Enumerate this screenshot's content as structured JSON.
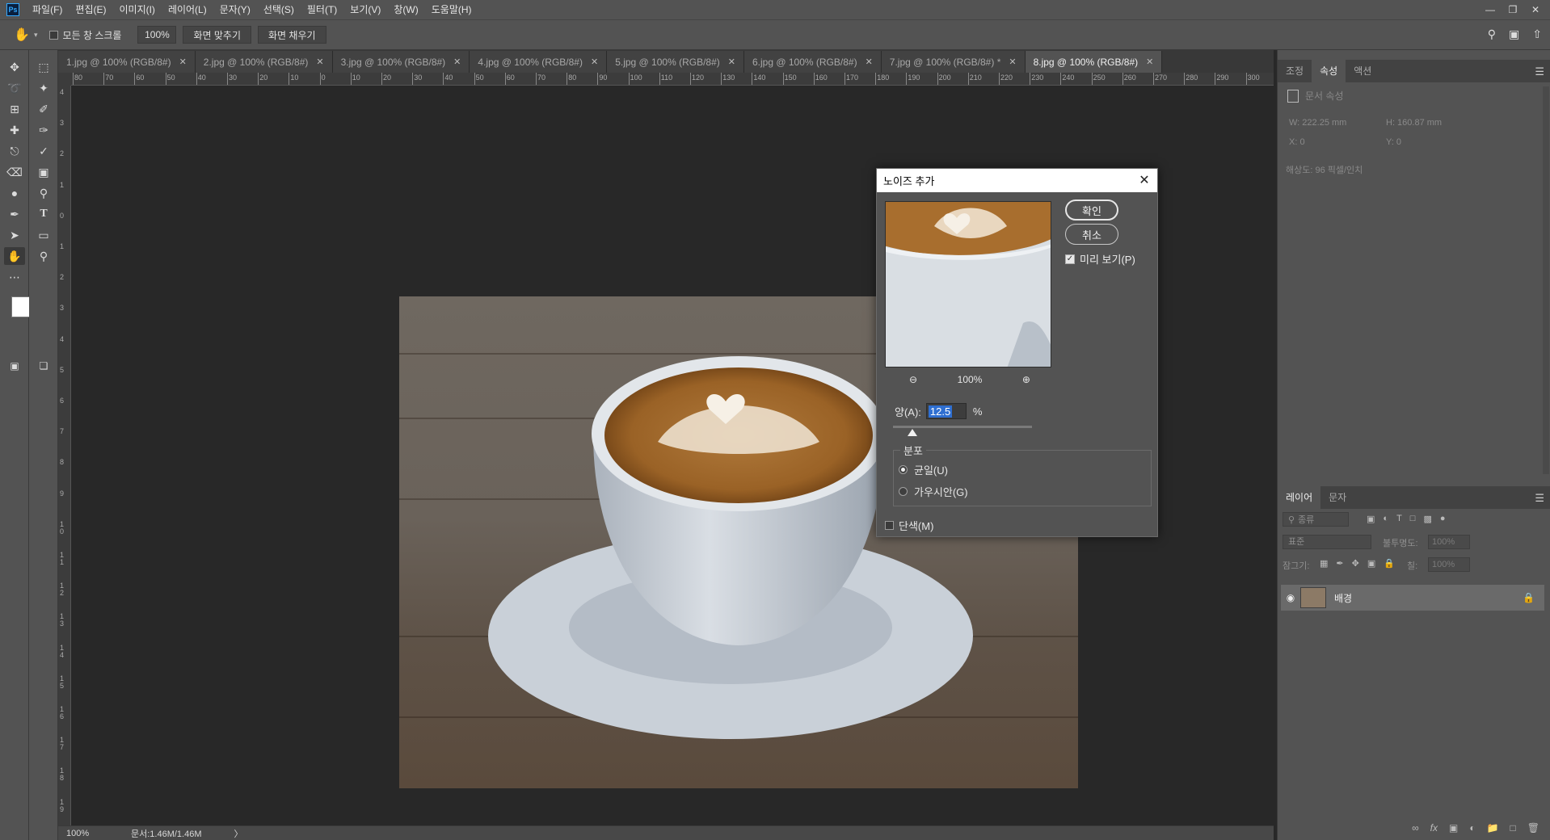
{
  "app": {
    "logo": "Ps"
  },
  "menu": [
    "파일(F)",
    "편집(E)",
    "이미지(I)",
    "레이어(L)",
    "문자(Y)",
    "선택(S)",
    "필터(T)",
    "보기(V)",
    "창(W)",
    "도움말(H)"
  ],
  "options": {
    "scroll_all_label": "모든 창 스크롤",
    "zoom_value": "100%",
    "fit_screen_label": "화면 맞추기",
    "fill_screen_label": "화면 채우기"
  },
  "tabs": [
    {
      "label": "1.jpg @ 100% (RGB/8#)",
      "active": false
    },
    {
      "label": "2.jpg @ 100% (RGB/8#)",
      "active": false
    },
    {
      "label": "3.jpg @ 100% (RGB/8#)",
      "active": false
    },
    {
      "label": "4.jpg @ 100% (RGB/8#)",
      "active": false
    },
    {
      "label": "5.jpg @ 100% (RGB/8#)",
      "active": false
    },
    {
      "label": "6.jpg @ 100% (RGB/8#)",
      "active": false
    },
    {
      "label": "7.jpg @ 100% (RGB/8#) *",
      "active": false
    },
    {
      "label": "8.jpg @ 100% (RGB/8#)",
      "active": true
    }
  ],
  "ruler": {
    "top_labels": [
      "80",
      "70",
      "60",
      "50",
      "40",
      "30",
      "20",
      "10",
      "0",
      "10",
      "20",
      "30",
      "40",
      "50",
      "60",
      "70",
      "80",
      "90",
      "100",
      "110",
      "120",
      "130",
      "140",
      "150",
      "160",
      "170",
      "180",
      "190",
      "200",
      "210",
      "220",
      "230",
      "240",
      "250",
      "260",
      "270",
      "280",
      "290",
      "300"
    ],
    "left_labels": [
      "4",
      "3",
      "2",
      "1",
      "0",
      "1",
      "2",
      "3",
      "4",
      "5",
      "6",
      "7",
      "8",
      "9",
      "10",
      "11",
      "12",
      "13",
      "14",
      "15",
      "16",
      "17",
      "18",
      "19",
      "20"
    ]
  },
  "status": {
    "zoom": "100%",
    "doc_info": "문서:1.46M/1.46M",
    "arrow": "〉"
  },
  "properties_panel": {
    "tabs": [
      "조정",
      "속성",
      "액션"
    ],
    "active_tab": "속성",
    "header": "문서 속성",
    "w": "W:  222.25 mm",
    "h": "H:  160.87 mm",
    "x": "X:  0",
    "y": "Y:  0",
    "resolution": "해상도: 96 픽셀/인치"
  },
  "layers_panel": {
    "tabs": [
      "레이어",
      "문자"
    ],
    "active_tab": "레이어",
    "filter_placeholder": "종류",
    "blend_mode": "표준",
    "opacity_label": "불투명도:",
    "opacity_value": "100%",
    "lock_label": "잠그기:",
    "fill_label": "칠:",
    "fill_value": "100%",
    "layers": [
      {
        "name": "배경",
        "visible": true,
        "locked": true
      }
    ]
  },
  "dialog": {
    "title": "노이즈 추가",
    "ok_label": "확인",
    "cancel_label": "취소",
    "preview_label": "미리 보기(P)",
    "preview_checked": true,
    "preview_zoom": "100%",
    "amount_label": "양(A):",
    "amount_value": "12.5",
    "amount_unit": "%",
    "distribution_label": "분포",
    "uniform_label": "균일(U)",
    "gaussian_label": "가우시안(G)",
    "selected_distribution": "uniform",
    "monochrome_label": "단색(M)",
    "monochrome_checked": false
  },
  "colors": {
    "foreground": "#ffffff",
    "background": "#e8341c",
    "accent": "#31a8ff"
  }
}
